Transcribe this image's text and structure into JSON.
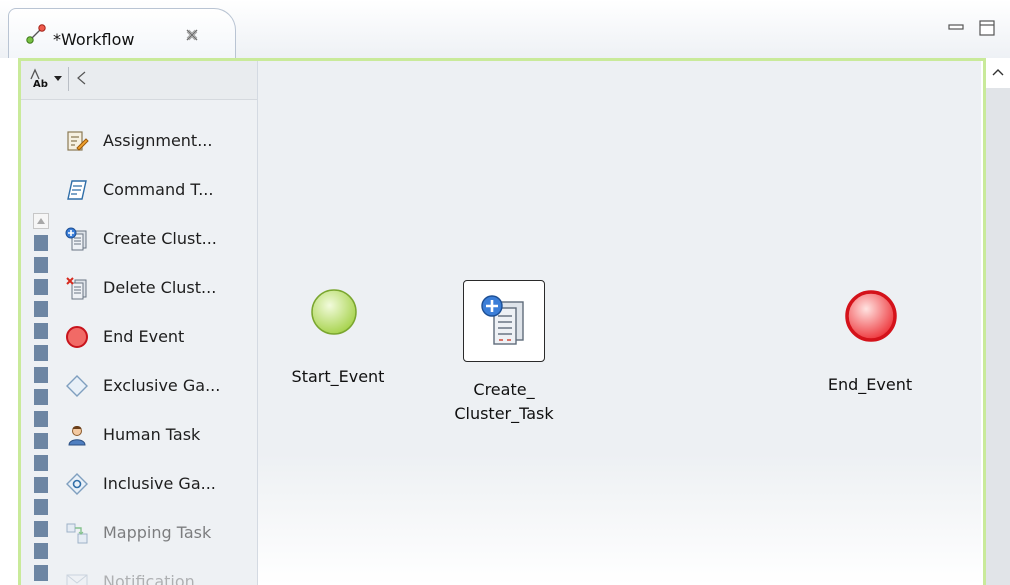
{
  "tab": {
    "title": "*Workflow",
    "icon": "workflow-icon"
  },
  "window_buttons": [
    "minimize-icon",
    "maximize-icon"
  ],
  "palette": {
    "items": [
      {
        "label": "Assignment...",
        "icon": "assignment-icon",
        "disabled": false
      },
      {
        "label": "Command T...",
        "icon": "command-task-icon",
        "disabled": false
      },
      {
        "label": "Create Clust...",
        "icon": "create-cluster-icon",
        "disabled": false
      },
      {
        "label": "Delete Clust...",
        "icon": "delete-cluster-icon",
        "disabled": false
      },
      {
        "label": "End Event",
        "icon": "end-event-icon",
        "disabled": false
      },
      {
        "label": "Exclusive Ga...",
        "icon": "exclusive-gateway-icon",
        "disabled": false
      },
      {
        "label": "Human Task",
        "icon": "human-task-icon",
        "disabled": false
      },
      {
        "label": "Inclusive Ga...",
        "icon": "inclusive-gateway-icon",
        "disabled": false
      },
      {
        "label": "Mapping Task",
        "icon": "mapping-task-icon",
        "disabled": true
      },
      {
        "label": "Notification ...",
        "icon": "notification-icon",
        "disabled": true
      }
    ]
  },
  "canvas": {
    "nodes": [
      {
        "label": "Start_Event",
        "type": "start-event"
      },
      {
        "label_line1": "Create_",
        "label_line2": "Cluster_Task",
        "type": "create-cluster-task"
      },
      {
        "label": "End_Event",
        "type": "end-event"
      }
    ]
  },
  "colors": {
    "accent_border": "#c9ea9a",
    "start_event": "#a9d451",
    "end_event": "#e0141c",
    "canvas_bg": "#edf0f3"
  }
}
